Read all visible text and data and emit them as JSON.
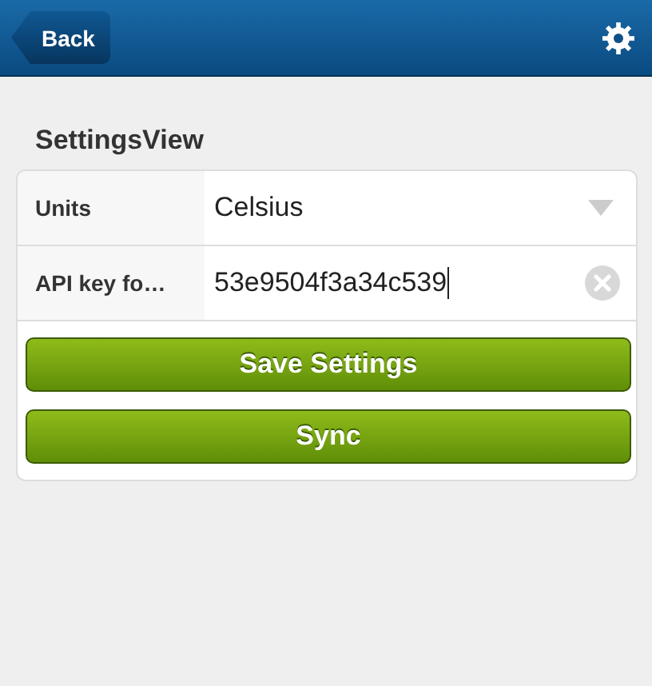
{
  "header": {
    "back": "Back"
  },
  "title": "SettingsView",
  "fields": [
    {
      "kind": "select",
      "label": "Units",
      "value": "Celsius"
    },
    {
      "kind": "text",
      "label": "API key fo…",
      "value": "53e9504f3a34c539"
    }
  ],
  "buttons": [
    "Save Settings",
    "Sync"
  ]
}
